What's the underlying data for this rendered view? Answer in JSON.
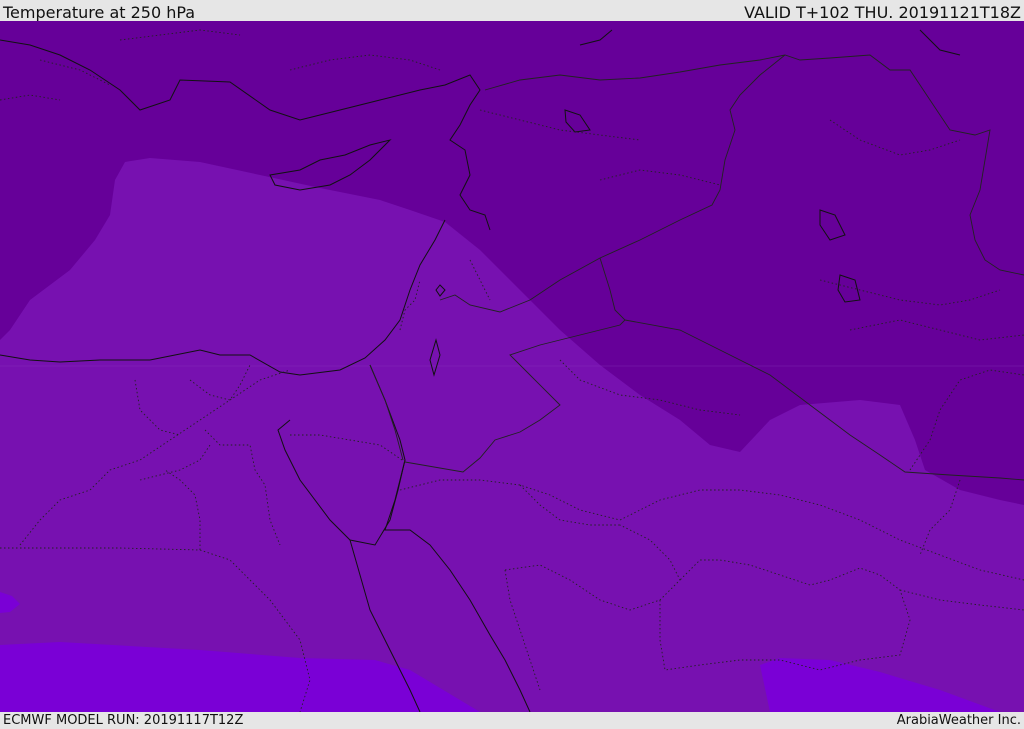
{
  "header": {
    "title": "Temperature at 250 hPa",
    "valid_time": "VALID T+102 THU. 20191121T18Z"
  },
  "footer": {
    "model_run": "ECMWF MODEL RUN: 20191117T12Z",
    "credit": "ArabiaWeather Inc."
  },
  "map": {
    "fill_colors": {
      "cold_band": "#660099",
      "mid_band": "#7711b0",
      "warm_band": "#7a00d6"
    },
    "line_colors": {
      "coastline": "#111111",
      "border": "#222222"
    }
  }
}
